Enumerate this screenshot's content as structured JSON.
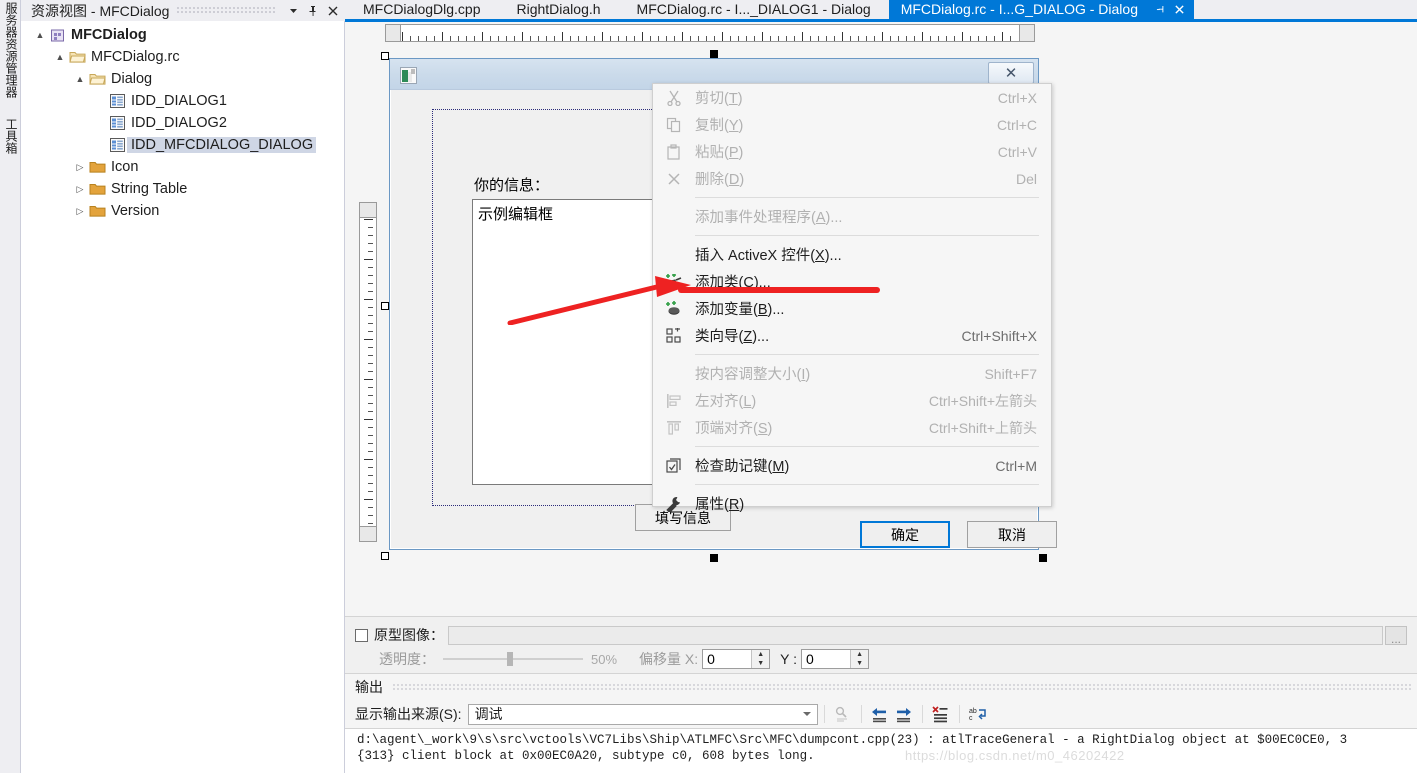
{
  "dock": {
    "labels": [
      "服务器资源管理器",
      "工具箱"
    ]
  },
  "resource_view": {
    "title_prefix": "资源视图",
    "title_sep": " - ",
    "title_name": "MFCDialog",
    "header_buttons": [
      "chevron-down-icon",
      "pin-icon",
      "close-icon"
    ],
    "tree": [
      {
        "indent": 0,
        "twist": "▲",
        "icon": "project-icon",
        "label": "MFCDialog",
        "bold": true,
        "selected": false
      },
      {
        "indent": 1,
        "twist": "▲",
        "icon": "folder-open-icon",
        "label": "MFCDialog.rc",
        "bold": false,
        "selected": false
      },
      {
        "indent": 2,
        "twist": "▲",
        "icon": "folder-open-icon",
        "label": "Dialog",
        "bold": false,
        "selected": false
      },
      {
        "indent": 3,
        "twist": "",
        "icon": "dialog-resource-icon",
        "label": "IDD_DIALOG1",
        "bold": false,
        "selected": false
      },
      {
        "indent": 3,
        "twist": "",
        "icon": "dialog-resource-icon",
        "label": "IDD_DIALOG2",
        "bold": false,
        "selected": false
      },
      {
        "indent": 3,
        "twist": "",
        "icon": "dialog-resource-icon",
        "label": "IDD_MFCDIALOG_DIALOG",
        "bold": false,
        "selected": true
      },
      {
        "indent": 2,
        "twist": "▷",
        "icon": "folder-icon",
        "label": "Icon",
        "bold": false,
        "selected": false
      },
      {
        "indent": 2,
        "twist": "▷",
        "icon": "folder-icon",
        "label": "String Table",
        "bold": false,
        "selected": false
      },
      {
        "indent": 2,
        "twist": "▷",
        "icon": "folder-icon",
        "label": "Version",
        "bold": false,
        "selected": false
      }
    ]
  },
  "tabs": {
    "items": [
      {
        "label": "MFCDialogDlg.cpp",
        "active": false
      },
      {
        "label": "RightDialog.h",
        "active": false
      },
      {
        "label": "MFCDialog.rc - I..._DIALOG1 - Dialog",
        "active": false
      },
      {
        "label": "MFCDialog.rc - I...G_DIALOG - Dialog",
        "active": true
      }
    ],
    "active_pin_icon": "pin-icon",
    "active_close_icon": "close-icon",
    "accent_color": "#0078d7"
  },
  "dialog_designer": {
    "app_icon": "mfc-app-icon",
    "close_button": "✕",
    "group_label": "你的信息：",
    "edit_text": "示例编辑框",
    "buttons": [
      {
        "label": "填写信息",
        "primary": false
      },
      {
        "label": "确定",
        "primary": true
      },
      {
        "label": "取消",
        "primary": false
      }
    ]
  },
  "prototype_bar": {
    "checkbox_checked": false,
    "image_label": "原型图像：",
    "image_value": "",
    "browse_label": "...",
    "opacity_label": "透明度：",
    "opacity_value": "50%",
    "offset_label": "偏移量 X:",
    "offset_x": "0",
    "offset_y_label": "Y :",
    "offset_y": "0"
  },
  "output": {
    "title": "输出",
    "source_label": "显示输出来源(S):",
    "source_value": "调试",
    "toolbar_icons": [
      "find-message-icon",
      "go-to-previous-message-icon",
      "go-to-next-message-icon",
      "clear-all-icon",
      "toggle-word-wrap-icon"
    ],
    "lines": [
      "d:\\agent\\_work\\9\\s\\src\\vctools\\VC7Libs\\Ship\\ATLMFC\\Src\\MFC\\dumpcont.cpp(23) : atlTraceGeneral - a RightDialog object at $00EC0CE0, 3",
      "{313} client block at 0x00EC0A20, subtype c0, 608 bytes long."
    ],
    "watermark": "https://blog.csdn.net/m0_46202422"
  },
  "context_menu": {
    "items": [
      {
        "icon": "cut-icon",
        "label": "剪切(T)",
        "accel": "T",
        "shortcut": "Ctrl+X",
        "disabled": true,
        "separator_after": false
      },
      {
        "icon": "copy-icon",
        "label": "复制(Y)",
        "accel": "Y",
        "shortcut": "Ctrl+C",
        "disabled": true,
        "separator_after": false
      },
      {
        "icon": "paste-icon",
        "label": "粘贴(P)",
        "accel": "P",
        "shortcut": "Ctrl+V",
        "disabled": true,
        "separator_after": false
      },
      {
        "icon": "delete-icon",
        "label": "删除(D)",
        "accel": "D",
        "shortcut": "Del",
        "disabled": true,
        "separator_after": true
      },
      {
        "icon": "",
        "label": "添加事件处理程序(A)...",
        "accel": "A",
        "shortcut": "",
        "disabled": true,
        "separator_after": true
      },
      {
        "icon": "",
        "label": "插入 ActiveX 控件(X)...",
        "accel": "X",
        "shortcut": "",
        "disabled": false,
        "separator_after": false
      },
      {
        "icon": "add-class-icon",
        "label": "添加类(C)...",
        "accel": "C",
        "shortcut": "",
        "disabled": false,
        "separator_after": false
      },
      {
        "icon": "add-variable-icon",
        "label": "添加变量(B)...",
        "accel": "B",
        "shortcut": "",
        "disabled": false,
        "separator_after": false
      },
      {
        "icon": "class-wizard-icon",
        "label": "类向导(Z)...",
        "accel": "Z",
        "shortcut": "Ctrl+Shift+X",
        "disabled": false,
        "separator_after": true
      },
      {
        "icon": "",
        "label": "按内容调整大小(I)",
        "accel": "I",
        "shortcut": "Shift+F7",
        "disabled": true,
        "separator_after": false
      },
      {
        "icon": "align-left-icon",
        "label": "左对齐(L)",
        "accel": "L",
        "shortcut": "Ctrl+Shift+左箭头",
        "disabled": true,
        "separator_after": false
      },
      {
        "icon": "align-top-icon",
        "label": "顶端对齐(S)",
        "accel": "S",
        "shortcut": "Ctrl+Shift+上箭头",
        "disabled": true,
        "separator_after": true
      },
      {
        "icon": "check-mnemonics-icon",
        "label": "检查助记键(M)",
        "accel": "M",
        "shortcut": "Ctrl+M",
        "disabled": false,
        "separator_after": true
      },
      {
        "icon": "properties-icon",
        "label": "属性(R)",
        "accel": "R",
        "shortcut": "",
        "disabled": false,
        "separator_after": false
      }
    ],
    "annotation_color": "#ee2222"
  }
}
